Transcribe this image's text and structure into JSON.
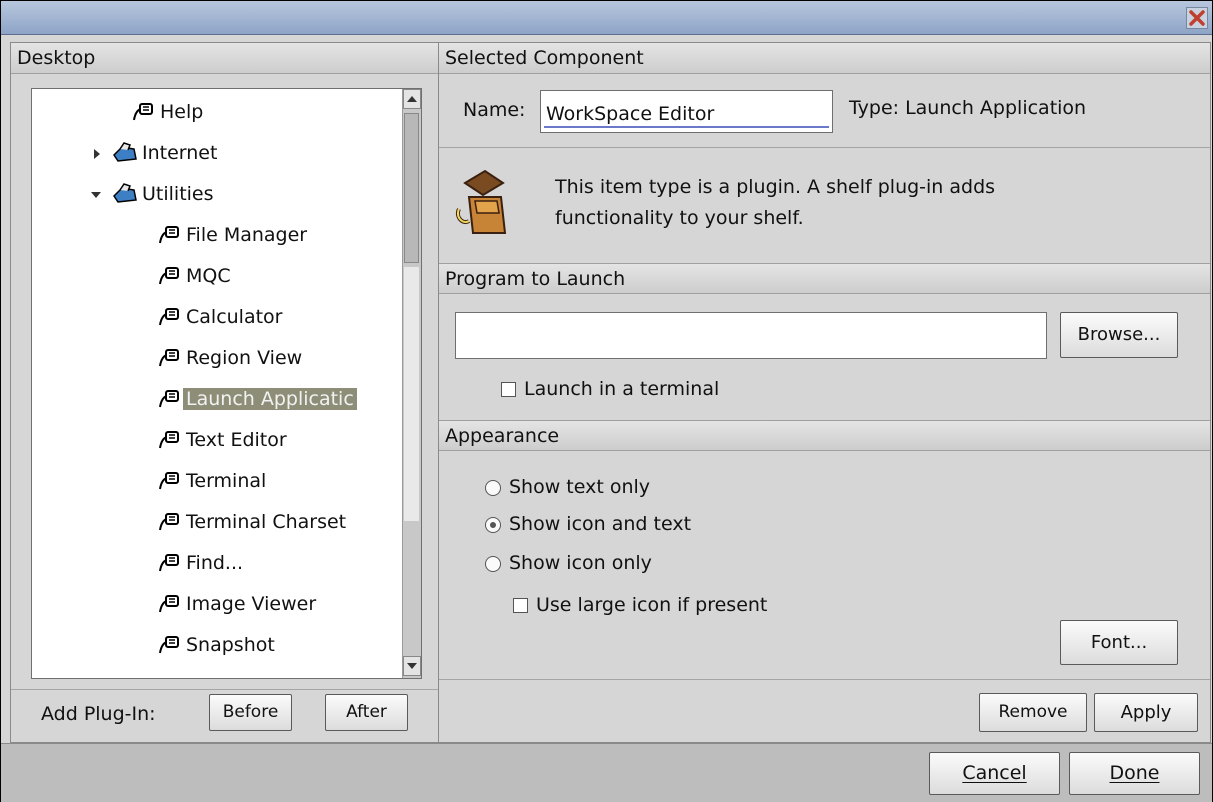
{
  "window": {
    "title": ""
  },
  "desktop": {
    "header": "Desktop",
    "tree": [
      {
        "label": "Help",
        "icon": "plugin-icon",
        "expander": ""
      },
      {
        "label": "Internet",
        "icon": "folder-icon",
        "expander": "collapsed"
      },
      {
        "label": "Utilities",
        "icon": "folder-icon",
        "expander": "expanded"
      },
      {
        "label": "File Manager",
        "icon": "plugin-icon",
        "expander": ""
      },
      {
        "label": "MQC",
        "icon": "plugin-icon",
        "expander": ""
      },
      {
        "label": "Calculator",
        "icon": "plugin-icon",
        "expander": ""
      },
      {
        "label": "Region View",
        "icon": "plugin-icon",
        "expander": ""
      },
      {
        "label": "Launch Applicatic",
        "icon": "plugin-icon",
        "expander": "",
        "selected": true
      },
      {
        "label": "Text Editor",
        "icon": "plugin-icon",
        "expander": ""
      },
      {
        "label": "Terminal",
        "icon": "plugin-icon",
        "expander": ""
      },
      {
        "label": "Terminal Charset",
        "icon": "plugin-icon",
        "expander": ""
      },
      {
        "label": "Find...",
        "icon": "plugin-icon",
        "expander": ""
      },
      {
        "label": "Image Viewer",
        "icon": "plugin-icon",
        "expander": ""
      },
      {
        "label": "Snapshot",
        "icon": "plugin-icon",
        "expander": ""
      }
    ],
    "add_plugin_label": "Add Plug-In:",
    "before_button": "Before",
    "after_button": "After"
  },
  "component": {
    "header": "Selected Component",
    "name_label": "Name:",
    "name_value": "WorkSpace Editor",
    "type_label": "Type: Launch Application",
    "description": "This item type is a plugin. A shelf plug-in adds functionality to your shelf.",
    "description_line1": "This item type is a plugin. A shelf plug-in adds",
    "description_line2": "functionality to your shelf."
  },
  "program": {
    "header": "Program to Launch",
    "path_value": "",
    "browse_button": "Browse...",
    "terminal_checkbox_label": "Launch in a terminal",
    "terminal_checked": false
  },
  "appearance": {
    "header": "Appearance",
    "options": [
      {
        "label": "Show text only",
        "selected": false
      },
      {
        "label": "Show icon and text",
        "selected": true
      },
      {
        "label": "Show icon only",
        "selected": false
      }
    ],
    "large_icon_label": "Use large icon if present",
    "large_icon_checked": false,
    "font_button": "Font..."
  },
  "actions": {
    "remove_button": "Remove",
    "apply_button": "Apply",
    "cancel_button": "Cancel",
    "done_button": "Done"
  },
  "colors": {
    "selection_bg": "#8e8e78",
    "titlebar": "#9fb3d2",
    "close_x": "#c04030"
  }
}
